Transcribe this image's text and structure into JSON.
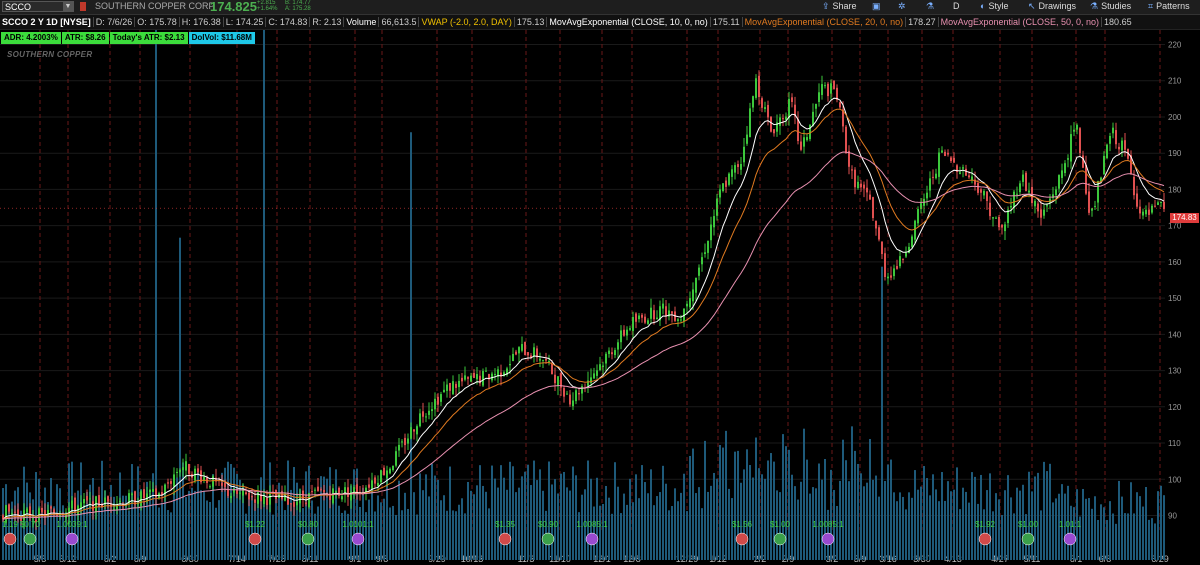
{
  "header": {
    "symbol": "SCCO",
    "company": "SOUTHERN COPPER CORP",
    "last": "174.825",
    "change": "+2.815",
    "change_pct": "+1.64%",
    "bid": "B: 174.77",
    "ask": "A: 175.28",
    "tools": [
      "Share",
      "D",
      "Style",
      "Drawings",
      "Studies",
      "Patterns"
    ]
  },
  "infobar": {
    "title": "SCCO 2 Y 1D [NYSE]",
    "date": "D: 7/6/26",
    "open": "O: 175.78",
    "high": "H: 176.38",
    "low": "L: 174.25",
    "close": "C: 174.83",
    "range": "R: 2.13",
    "volume_label": "Volume",
    "volume": "66,613.5",
    "vwap_label": "VWAP (-2.0, 2.0, DAY)",
    "vwap": "175.13",
    "ema10_label": "MovAvgExponential (CLOSE, 10, 0, no)",
    "ema10": "175.11",
    "ema20_label": "MovAvgExponential (CLOSE, 20, 0, no)",
    "ema20": "178.27",
    "ema50_label": "MovAvgExponential (CLOSE, 50, 0, no)",
    "ema50": "180.65"
  },
  "badges": {
    "adr": "ADR: 4.2003%",
    "atr": "ATR: $8.26",
    "today_atr": "Today's ATR: $2.13",
    "dolvol": "DolVol: $11.68M"
  },
  "watermark": "SOUTHERN COPPER",
  "price_tag": "174.83",
  "colors": {
    "up": "#3cc83c",
    "down": "#e05050",
    "ema10": "#ffffff",
    "ema20": "#e07a20",
    "ema50": "#e890b0",
    "volume": "#1e5a7a",
    "vwap": "#f0c000"
  },
  "chart_data": {
    "type": "candlestick",
    "price_axis_ticks": [
      90,
      100,
      110,
      120,
      130,
      140,
      150,
      160,
      170,
      180,
      190,
      200,
      210,
      220
    ],
    "ylim": [
      86,
      224
    ],
    "date_labels": [
      "5/5",
      "5/12",
      "6/2",
      "6/9",
      "6/30",
      "7/14",
      "7/28",
      "8/11",
      "9/1",
      "9/8",
      "9/29",
      "10/13",
      "11/3",
      "11/10",
      "12/1",
      "12/8",
      "12/29",
      "1/12",
      "2/2",
      "2/9",
      "3/2",
      "3/9",
      "3/16",
      "3/30",
      "4/13",
      "4/27",
      "5/11",
      "6/1",
      "6/8",
      "6/29"
    ],
    "approx_close_path": [
      [
        0,
        91
      ],
      [
        40,
        90
      ],
      [
        80,
        93
      ],
      [
        120,
        94
      ],
      [
        160,
        96
      ],
      [
        180,
        104
      ],
      [
        200,
        101
      ],
      [
        230,
        96
      ],
      [
        260,
        95
      ],
      [
        290,
        94
      ],
      [
        320,
        96
      ],
      [
        360,
        97
      ],
      [
        390,
        104
      ],
      [
        420,
        118
      ],
      [
        450,
        126
      ],
      [
        480,
        128
      ],
      [
        500,
        130
      ],
      [
        520,
        136
      ],
      [
        540,
        134
      ],
      [
        570,
        122
      ],
      [
        600,
        132
      ],
      [
        630,
        143
      ],
      [
        660,
        147
      ],
      [
        680,
        145
      ],
      [
        700,
        160
      ],
      [
        720,
        180
      ],
      [
        740,
        188
      ],
      [
        755,
        210
      ],
      [
        770,
        196
      ],
      [
        790,
        204
      ],
      [
        800,
        190
      ],
      [
        820,
        208
      ],
      [
        835,
        207
      ],
      [
        850,
        184
      ],
      [
        870,
        176
      ],
      [
        885,
        156
      ],
      [
        900,
        160
      ],
      [
        920,
        175
      ],
      [
        940,
        190
      ],
      [
        960,
        186
      ],
      [
        980,
        180
      ],
      [
        1000,
        168
      ],
      [
        1020,
        184
      ],
      [
        1040,
        172
      ],
      [
        1060,
        184
      ],
      [
        1075,
        198
      ],
      [
        1090,
        172
      ],
      [
        1110,
        196
      ],
      [
        1125,
        190
      ],
      [
        1140,
        172
      ],
      [
        1160,
        175
      ]
    ],
    "event_labels": [
      "1.19",
      "$0.70",
      "1.0039:1",
      "$1.22",
      "$0.80",
      "1.0101:1",
      "$1.35",
      "$0.90",
      "1.0085:1",
      "$1.56",
      "$1.00",
      "1.0085:1",
      "$1.92",
      "$1.00",
      "1.01:1"
    ],
    "series": [
      {
        "name": "MovAvgExponential (CLOSE, 10, 0, no)"
      },
      {
        "name": "MovAvgExponential (CLOSE, 20, 0, no)"
      },
      {
        "name": "MovAvgExponential (CLOSE, 50, 0, no)"
      },
      {
        "name": "Volume"
      }
    ]
  }
}
